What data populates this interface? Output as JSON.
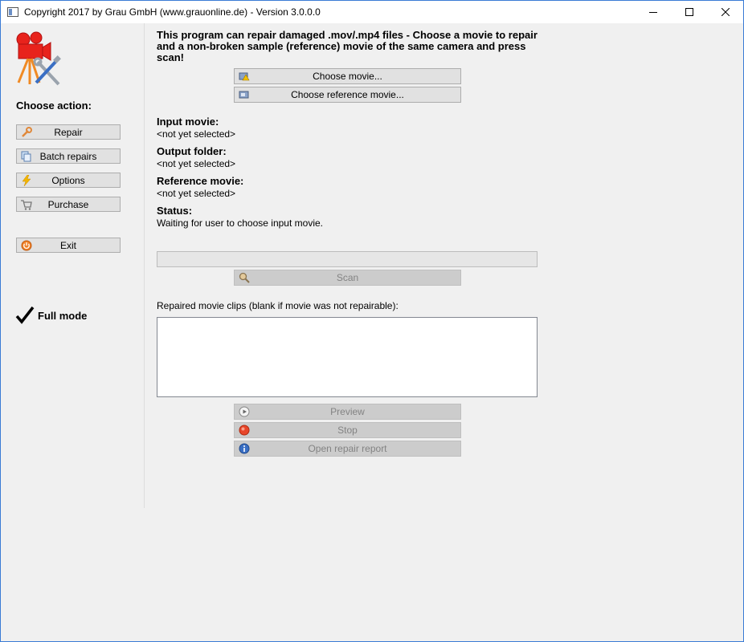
{
  "window": {
    "title": "Copyright 2017 by Grau GmbH (www.grauonline.de) - Version 3.0.0.0"
  },
  "sidebar": {
    "choose_action": "Choose action:",
    "buttons": [
      {
        "label": "Repair",
        "icon": "wrench-icon"
      },
      {
        "label": "Batch repairs",
        "icon": "copy-icon"
      },
      {
        "label": "Options",
        "icon": "lightning-icon"
      },
      {
        "label": "Purchase",
        "icon": "cart-icon"
      }
    ],
    "exit_label": "Exit",
    "full_mode": "Full mode"
  },
  "main": {
    "intro": "This program can repair damaged .mov/.mp4 files - Choose a movie to repair and a non-broken sample (reference) movie of the same camera and press scan!",
    "choose_movie": "Choose movie...",
    "choose_reference": "Choose reference movie...",
    "input_movie_label": "Input movie:",
    "input_movie_value": "<not yet selected>",
    "output_folder_label": "Output folder:",
    "output_folder_value": "<not yet selected>",
    "reference_movie_label": "Reference movie:",
    "reference_movie_value": "<not yet selected>",
    "status_label": "Status:",
    "status_value": "Waiting for user to choose input movie.",
    "scan": "Scan",
    "clips_label": "Repaired movie clips (blank if movie was not repairable):",
    "preview": "Preview",
    "stop": "Stop",
    "open_report": "Open repair report"
  },
  "colors": {
    "accent": "#3a7bd5",
    "logo_red": "#e8231c",
    "logo_orange": "#f08a24",
    "stop_red": "#e8462a",
    "info_blue": "#3a6fc4"
  }
}
